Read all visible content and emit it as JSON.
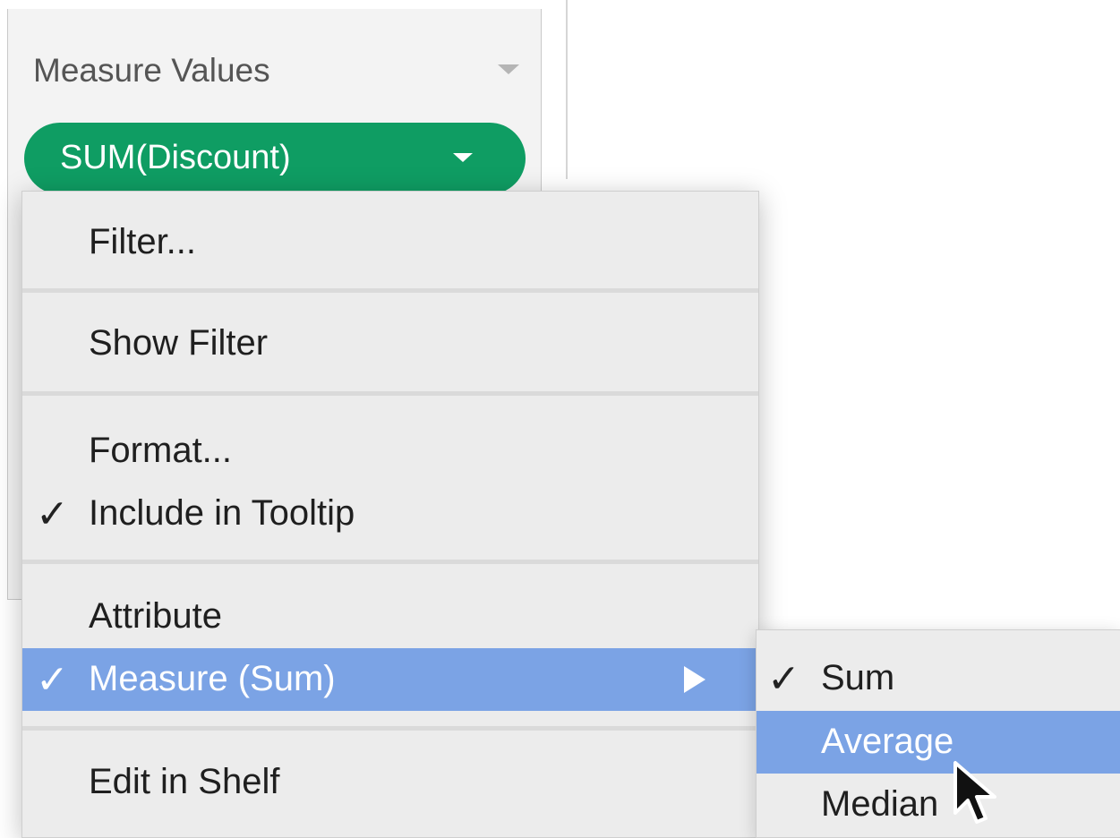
{
  "card": {
    "title": "Measure Values"
  },
  "pill": {
    "label": "SUM(Discount)",
    "color": "#0f9d63"
  },
  "context_menu": {
    "items": [
      {
        "label": "Filter...",
        "checked": false,
        "highlighted": false
      },
      {
        "label": "Show Filter",
        "checked": false,
        "highlighted": false
      },
      {
        "label": "Format...",
        "checked": false,
        "highlighted": false
      },
      {
        "label": "Include in Tooltip",
        "checked": true,
        "highlighted": false
      },
      {
        "label": "Attribute",
        "checked": false,
        "highlighted": false
      },
      {
        "label": "Measure (Sum)",
        "checked": true,
        "highlighted": true,
        "has_submenu": true
      },
      {
        "label": "Edit in Shelf",
        "checked": false,
        "highlighted": false
      }
    ],
    "check_glyph": "✓",
    "highlight_color": "#7ba3e5"
  },
  "submenu": {
    "items": [
      {
        "label": "Sum",
        "checked": true,
        "highlighted": false
      },
      {
        "label": "Average",
        "checked": false,
        "highlighted": true
      },
      {
        "label": "Median",
        "checked": false,
        "highlighted": false
      }
    ]
  },
  "cursor": {
    "icon": "arrow-pointer-icon"
  }
}
